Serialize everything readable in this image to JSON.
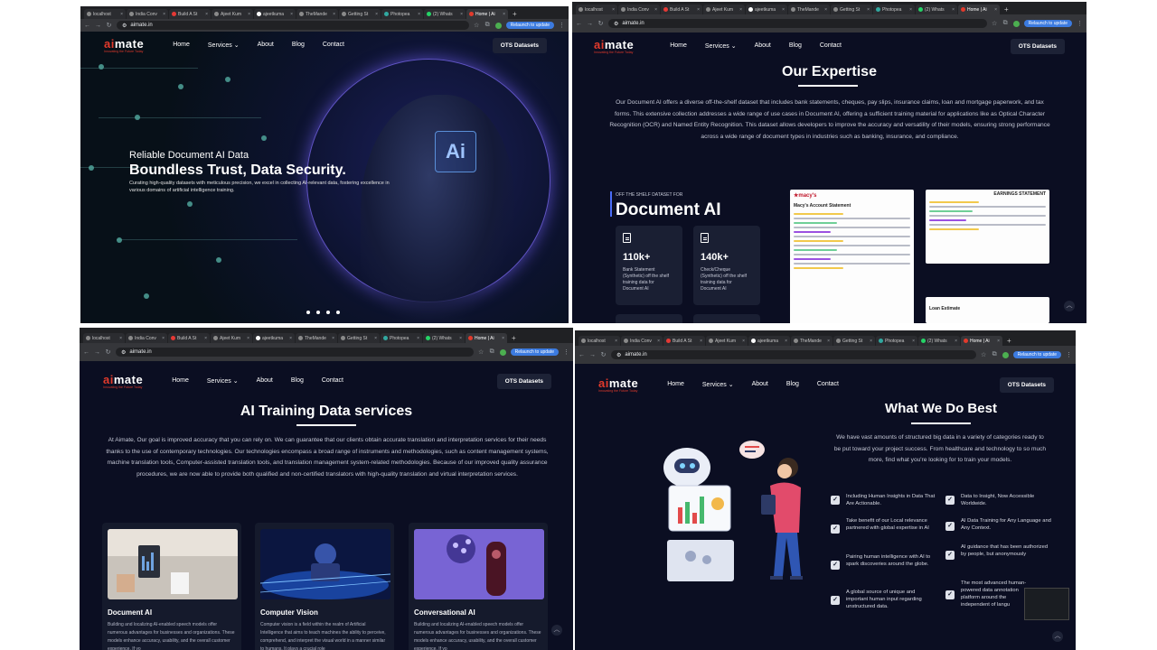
{
  "browser": {
    "tabs": [
      "localhost",
      "India Conv",
      "Build A St",
      "Ajeet Kum",
      "ajeetkuma",
      "TheMande",
      "Getting St",
      "Photopea",
      "(2) Whats",
      "Home | Ai"
    ],
    "new_tab": "+",
    "url": "aimate.in",
    "relaunch_label": "Relaunch to update"
  },
  "site": {
    "logo_prefix": "ai",
    "logo_suffix": "mate",
    "logo_tagline": "Innovating the Future Today",
    "nav": [
      "Home",
      "Services",
      "About",
      "Blog",
      "Contact"
    ],
    "services_caret": "⌄",
    "ots_button": "OTS Datasets"
  },
  "hero": {
    "subtitle": "Reliable Document AI Data",
    "title": "Boundless Trust, Data Security.",
    "body": "Curating high-quality datasets with meticulous precision, we excel in collecting AI-relevant data, fostering excellence in various domains of artificial intelligence training.",
    "chip_text": "Ai"
  },
  "expertise": {
    "title": "Our Expertise",
    "body": "Our Document AI offers a diverse off-the-shelf dataset that includes bank statements, cheques, pay slips, insurance claims, loan and mortgage paperwork, and tax forms. This extensive collection addresses a wide range of use cases in Document AI, offering a sufficient training material for applications like as Optical Character Recognition (OCR) and Named Entity Recognition. This dataset allows developers to improve the accuracy and versatility of their models, ensuring strong performance across a wide range of document types in industries such as banking, insurance, and compliance.",
    "ots_label": "OFF THE SHELF DATASET FOR",
    "doc_title": "Document AI",
    "stats": [
      {
        "value": "110k+",
        "caption": "Bank Statement (Synthetic) off the shelf training data for Document AI"
      },
      {
        "value": "140k+",
        "caption": "Check/Cheque (Synthetic) off the shelf training data for Document AI"
      }
    ],
    "sheet1_brand": "★macy's",
    "sheet1_heading": "Macy's Account Statement",
    "sheet2_heading": "EARNINGS STATEMENT",
    "sheet3_heading": "Loan Estimate",
    "scroll_icon": "︿"
  },
  "training": {
    "title": "AI Training Data services",
    "body": "At Aimate, Our goal is improved accuracy that you can rely on. We can guarantee that our clients obtain accurate translation and interpretation services for their needs thanks to the use of contemporary technologies. Our technologies encompass a broad range of instruments and methodologies, such as content management systems, machine translation tools, Computer-assisted translation tools, and translation management system-related methodologies. Because of our improved quality assurance procedures, we are now able to provide both qualified and non-certified translators with high-quality translation and virtual interpretation services.",
    "cards": [
      {
        "title": "Document AI",
        "body": "Building and localizing AI-enabled speech models offer numerous advantages for businesses and organizations. These models enhance accuracy, usability, and the overall customer experience. If yo"
      },
      {
        "title": "Computer Vision",
        "body": "Computer vision is a field within the realm of Artificial Intelligence that aims to teach machines the ability to perceive, comprehend, and interpret the visual world in a manner similar to humans. It plays a crucial role"
      },
      {
        "title": "Conversational AI",
        "body": "Building and localizing AI-enabled speech models offer numerous advantages for businesses and organizations. These models enhance accuracy, usability, and the overall customer experience. If yo"
      }
    ]
  },
  "best": {
    "title": "What We Do Best",
    "body": "We have vast amounts of structured big data in a variety of categories ready to be put toward your project success. From healthcare and technology to so much more, find what you're looking for to train your models.",
    "check": "✓",
    "left_items": [
      "Including Human Insights in Data That Are Actionable.",
      "Take benefit of our Local relevance partnered with global expertise in AI",
      "Pairing human intelligence with AI to spark discoveries around the globe.",
      "A global source of unique and important human input regarding unstructured data."
    ],
    "right_items": [
      "Data to Insight, Now Accessible Worldwide.",
      "AI Data Training for Any Language and Any Context.",
      "AI guidance that has been authorized by people, but anonymously",
      "The most advanced human-powered data annotation platform around the independent of langu"
    ]
  }
}
